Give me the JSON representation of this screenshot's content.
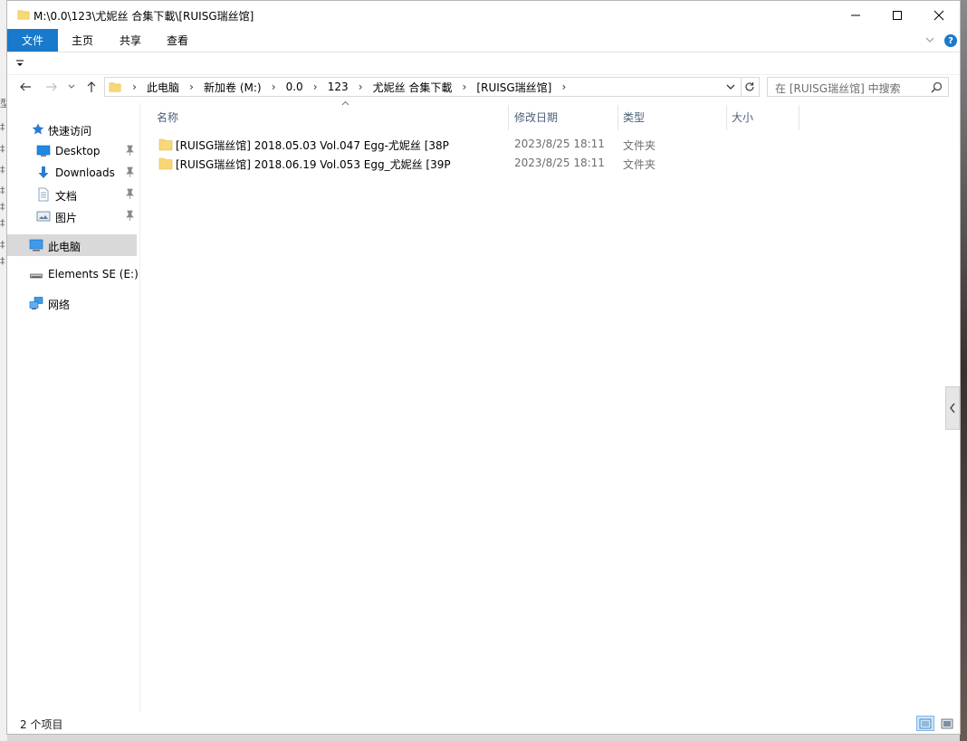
{
  "window": {
    "title": "M:\\0.0\\123\\尤妮丝 合集下載\\[RUISG瑞丝馆]"
  },
  "ribbon": {
    "tabs": [
      "文件",
      "主页",
      "共享",
      "查看"
    ],
    "accent_color": "#1979ca"
  },
  "address_bar": {
    "breadcrumbs": [
      "此电脑",
      "新加卷 (M:)",
      "0.0",
      "123",
      "尤妮丝 合集下載",
      "[RUISG瑞丝馆]"
    ]
  },
  "search": {
    "placeholder": "在 [RUISG瑞丝馆] 中搜索"
  },
  "nav_pane": {
    "items": [
      {
        "label": "快速访问",
        "icon": "star-icon"
      },
      {
        "label": "Desktop",
        "icon": "desktop-icon",
        "pinned": true
      },
      {
        "label": "Downloads",
        "icon": "download-icon",
        "pinned": true
      },
      {
        "label": "文档",
        "icon": "document-icon",
        "pinned": true
      },
      {
        "label": "图片",
        "icon": "picture-icon",
        "pinned": true
      },
      {
        "label": "此电脑",
        "icon": "computer-icon",
        "selected": true
      },
      {
        "label": "Elements SE (E:)",
        "icon": "drive-icon"
      },
      {
        "label": "网络",
        "icon": "network-icon"
      }
    ]
  },
  "file_list": {
    "columns": [
      "名称",
      "修改日期",
      "类型",
      "大小"
    ],
    "rows": [
      {
        "name": "[RUISG瑞丝馆] 2018.05.03 Vol.047 Egg-尤妮丝 [38P",
        "modified": "2023/8/25 18:11",
        "type": "文件夹"
      },
      {
        "name": "[RUISG瑞丝馆] 2018.06.19 Vol.053 Egg_尤妮丝 [39P",
        "modified": "2023/8/25 18:11",
        "type": "文件夹"
      }
    ]
  },
  "status_bar": {
    "item_count": "2 个项目"
  },
  "background_fragments": [
    "型",
    "‡",
    "‡",
    "‡",
    "‡",
    "‡",
    "‡",
    "‡",
    "‡"
  ]
}
